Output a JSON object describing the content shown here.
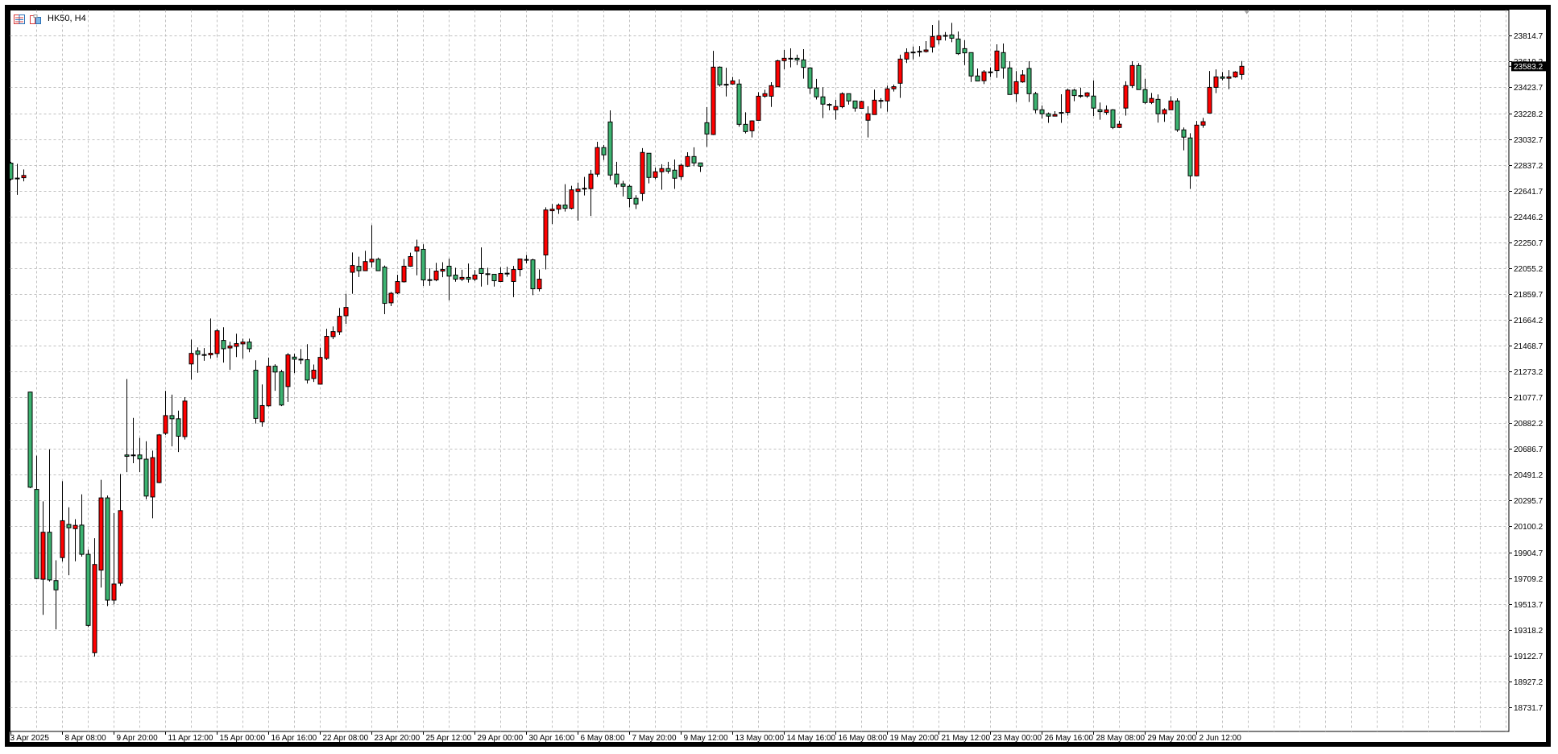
{
  "header": {
    "title": "HK50, H4",
    "icons": [
      "chart-list-icon",
      "one-click-trading-icon"
    ]
  },
  "colors": {
    "bull": "#ff0000",
    "bear": "#3cb371",
    "wick": "#000000",
    "grid": "#c0c0c0",
    "price_label_bg": "#000000",
    "price_label_fg": "#ffffff"
  },
  "current_price": "23583.2",
  "chart_data": {
    "type": "candlestick",
    "symbol": "HK50",
    "timeframe": "H4",
    "title": "HK50, H4",
    "xlabel": "",
    "ylabel": "",
    "ylim": [
      18548,
      24009
    ],
    "grid": true,
    "y_ticks": [
      "23814.7",
      "23619.2",
      "23423.7",
      "23228.2",
      "23032.7",
      "22837.2",
      "22641.7",
      "22446.2",
      "22250.7",
      "22055.2",
      "21859.7",
      "21664.2",
      "21468.7",
      "21273.2",
      "21077.7",
      "20882.2",
      "20686.7",
      "20491.2",
      "20295.7",
      "20100.2",
      "19904.7",
      "19709.2",
      "19513.7",
      "19318.2",
      "19122.7",
      "18927.2",
      "18731.7"
    ],
    "x_labels": [
      "3 Apr 2025",
      "8 Apr 08:00",
      "9 Apr 20:00",
      "11 Apr 12:00",
      "15 Apr 00:00",
      "16 Apr 16:00",
      "22 Apr 08:00",
      "23 Apr 20:00",
      "25 Apr 12:00",
      "29 Apr 00:00",
      "30 Apr 16:00",
      "6 May 08:00",
      "7 May 20:00",
      "9 May 12:00",
      "13 May 00:00",
      "14 May 16:00",
      "16 May 08:00",
      "19 May 20:00",
      "21 May 12:00",
      "23 May 00:00",
      "26 May 16:00",
      "28 May 08:00",
      "29 May 20:00",
      "2 Jun 12:00"
    ],
    "x_label_every_bars": 8,
    "ohlc_fields": [
      "open",
      "high",
      "low",
      "close"
    ],
    "ohlc": [
      [
        22850,
        22860,
        22720,
        22730
      ],
      [
        22737,
        22845,
        22610,
        22737
      ],
      [
        22740,
        22802,
        22712,
        22757
      ],
      [
        21117,
        21120,
        20390,
        20397
      ],
      [
        20380,
        20636,
        19700,
        19705
      ],
      [
        19700,
        20290,
        19431,
        20056
      ],
      [
        20056,
        20683,
        19683,
        19695
      ],
      [
        19690,
        19844,
        19321,
        19620
      ],
      [
        19864,
        20442,
        19834,
        20143
      ],
      [
        20115,
        20245,
        19730,
        20090
      ],
      [
        20083,
        20155,
        19836,
        20108
      ],
      [
        20110,
        20343,
        19871,
        19889
      ],
      [
        19889,
        19924,
        19338,
        19351
      ],
      [
        19144,
        20011,
        19114,
        19812
      ],
      [
        19769,
        20453,
        19637,
        20316
      ],
      [
        20316,
        20334,
        19497,
        19542
      ],
      [
        19542,
        20201,
        19510,
        19664
      ],
      [
        19670,
        20497,
        19650,
        20220
      ],
      [
        20641,
        21216,
        20511,
        20631
      ],
      [
        20641,
        20922,
        20579,
        20641
      ],
      [
        20641,
        20770,
        20511,
        20611
      ],
      [
        20609,
        20745,
        20305,
        20330
      ],
      [
        20323,
        20674,
        20162,
        20621
      ],
      [
        20432,
        20800,
        20427,
        20793
      ],
      [
        20805,
        21126,
        20793,
        20939
      ],
      [
        20939,
        21098,
        20706,
        20915
      ],
      [
        20915,
        20977,
        20663,
        20783
      ],
      [
        20780,
        21079,
        20758,
        21049
      ],
      [
        21330,
        21515,
        21211,
        21410
      ],
      [
        21428,
        21455,
        21263,
        21403
      ],
      [
        21401,
        21450,
        21354,
        21401
      ],
      [
        21399,
        21674,
        21370,
        21411
      ],
      [
        21409,
        21596,
        21378,
        21581
      ],
      [
        21508,
        21608,
        21340,
        21445
      ],
      [
        21451,
        21498,
        21285,
        21466
      ],
      [
        21463,
        21559,
        21382,
        21484
      ],
      [
        21482,
        21522,
        21370,
        21496
      ],
      [
        21496,
        21522,
        21419,
        21445
      ],
      [
        21283,
        21358,
        20879,
        20918
      ],
      [
        20891,
        21175,
        20855,
        21015
      ],
      [
        21013,
        21378,
        21007,
        21313
      ],
      [
        21313,
        21328,
        21127,
        21269
      ],
      [
        21271,
        21285,
        21011,
        21019
      ],
      [
        21159,
        21413,
        21043,
        21399
      ],
      [
        21382,
        21407,
        21261,
        21366
      ],
      [
        21366,
        21443,
        21328,
        21366
      ],
      [
        21362,
        21480,
        21182,
        21208
      ],
      [
        21220,
        21326,
        21194,
        21283
      ],
      [
        21177,
        21453,
        21173,
        21380
      ],
      [
        21372,
        21596,
        21360,
        21539
      ],
      [
        21537,
        21614,
        21518,
        21575
      ],
      [
        21573,
        21754,
        21549,
        21691
      ],
      [
        21695,
        21862,
        21634,
        21758
      ],
      [
        22024,
        22174,
        21862,
        22075
      ],
      [
        22069,
        22142,
        21988,
        22036
      ],
      [
        22036,
        22186,
        22036,
        22105
      ],
      [
        22103,
        22381,
        22061,
        22123
      ],
      [
        22123,
        22135,
        22036,
        22036
      ],
      [
        22063,
        22075,
        21707,
        21789
      ],
      [
        21793,
        21875,
        21768,
        21865
      ],
      [
        21867,
        22005,
        21859,
        21954
      ],
      [
        21952,
        22125,
        21946,
        22070
      ],
      [
        22070,
        22173,
        22066,
        22143
      ],
      [
        22184,
        22271,
        22001,
        22216
      ],
      [
        22198,
        22236,
        21920,
        21966
      ],
      [
        21968,
        22054,
        21922,
        21968
      ],
      [
        21966,
        22096,
        21956,
        22033
      ],
      [
        22033,
        22100,
        21987,
        22045
      ],
      [
        22070,
        22127,
        21812,
        21995
      ],
      [
        22003,
        22058,
        21952,
        21972
      ],
      [
        21972,
        22043,
        21958,
        21985
      ],
      [
        21985,
        22090,
        21946,
        21972
      ],
      [
        21972,
        22041,
        21958,
        22003
      ],
      [
        22052,
        22212,
        21916,
        22015
      ],
      [
        22013,
        22058,
        21928,
        22013
      ],
      [
        22009,
        22009,
        21916,
        21960
      ],
      [
        21954,
        22062,
        21954,
        22015
      ],
      [
        22017,
        22066,
        21990,
        22017
      ],
      [
        21954,
        22072,
        21836,
        22045
      ],
      [
        22045,
        22125,
        21993,
        22125
      ],
      [
        22121,
        22155,
        22092,
        22121
      ],
      [
        22118,
        22127,
        21851,
        21899
      ],
      [
        21899,
        22045,
        21879,
        21972
      ],
      [
        22155,
        22516,
        22045,
        22496
      ],
      [
        22490,
        22541,
        22389,
        22502
      ],
      [
        22502,
        22545,
        22466,
        22533
      ],
      [
        22533,
        22691,
        22484,
        22508
      ],
      [
        22508,
        22679,
        22500,
        22648
      ],
      [
        22636,
        22703,
        22415,
        22654
      ],
      [
        22660,
        22746,
        22606,
        22660
      ],
      [
        22657,
        22799,
        22450,
        22767
      ],
      [
        22767,
        23012,
        22746,
        22968
      ],
      [
        22968,
        22988,
        22874,
        22913
      ],
      [
        23162,
        23250,
        22722,
        22760
      ],
      [
        22767,
        22860,
        22667,
        22693
      ],
      [
        22693,
        22716,
        22598,
        22675
      ],
      [
        22675,
        22687,
        22515,
        22582
      ],
      [
        22584,
        22608,
        22503,
        22541
      ],
      [
        22620,
        22964,
        22564,
        22931
      ],
      [
        22925,
        22925,
        22697,
        22742
      ],
      [
        22742,
        22817,
        22728,
        22785
      ],
      [
        22785,
        22842,
        22649,
        22809
      ],
      [
        22809,
        22860,
        22771,
        22789
      ],
      [
        22797,
        22878,
        22655,
        22736
      ],
      [
        22748,
        22848,
        22724,
        22834
      ],
      [
        22827,
        22933,
        22821,
        22900
      ],
      [
        22900,
        22970,
        22827,
        22852
      ],
      [
        22852,
        22852,
        22783,
        22827
      ],
      [
        23156,
        23274,
        22974,
        23071
      ],
      [
        23067,
        23700,
        23063,
        23577
      ],
      [
        23577,
        23583,
        23430,
        23443
      ],
      [
        23447,
        23572,
        23355,
        23447
      ],
      [
        23449,
        23503,
        23443,
        23473
      ],
      [
        23449,
        23485,
        23126,
        23144
      ],
      [
        23144,
        23235,
        23075,
        23089
      ],
      [
        23095,
        23174,
        23045,
        23170
      ],
      [
        23174,
        23388,
        23174,
        23357
      ],
      [
        23357,
        23406,
        23345,
        23376
      ],
      [
        23357,
        23463,
        23276,
        23437
      ],
      [
        23428,
        23633,
        23428,
        23625
      ],
      [
        23626,
        23707,
        23561,
        23644
      ],
      [
        23644,
        23719,
        23575,
        23644
      ],
      [
        23644,
        23671,
        23593,
        23632
      ],
      [
        23632,
        23713,
        23490,
        23575
      ],
      [
        23571,
        23577,
        23374,
        23419
      ],
      [
        23419,
        23488,
        23332,
        23352
      ],
      [
        23352,
        23425,
        23191,
        23297
      ],
      [
        23295,
        23303,
        23250,
        23295
      ],
      [
        23254,
        23330,
        23179,
        23279
      ],
      [
        23277,
        23386,
        23266,
        23376
      ],
      [
        23376,
        23376,
        23293,
        23321
      ],
      [
        23321,
        23321,
        23240,
        23267
      ],
      [
        23265,
        23323,
        23265,
        23317
      ],
      [
        23175,
        23281,
        23045,
        23224
      ],
      [
        23218,
        23407,
        23218,
        23327
      ],
      [
        23325,
        23342,
        23265,
        23325
      ],
      [
        23321,
        23437,
        23240,
        23413
      ],
      [
        23413,
        23445,
        23392,
        23429
      ],
      [
        23455,
        23671,
        23344,
        23638
      ],
      [
        23638,
        23719,
        23608,
        23687
      ],
      [
        23691,
        23733,
        23636,
        23691
      ],
      [
        23697,
        23737,
        23656,
        23697
      ],
      [
        23695,
        23774,
        23687,
        23707
      ],
      [
        23729,
        23896,
        23687,
        23809
      ],
      [
        23784,
        23930,
        23748,
        23815
      ],
      [
        23817,
        23843,
        23778,
        23817
      ],
      [
        23821,
        23912,
        23766,
        23796
      ],
      [
        23790,
        23847,
        23669,
        23679
      ],
      [
        23717,
        23780,
        23593,
        23685
      ],
      [
        23687,
        23687,
        23465,
        23510
      ],
      [
        23510,
        23567,
        23472,
        23472
      ],
      [
        23474,
        23555,
        23449,
        23541
      ],
      [
        23541,
        23575,
        23502,
        23541
      ],
      [
        23551,
        23750,
        23496,
        23699
      ],
      [
        23687,
        23756,
        23490,
        23571
      ],
      [
        23571,
        23622,
        23370,
        23370
      ],
      [
        23376,
        23547,
        23313,
        23467
      ],
      [
        23465,
        23555,
        23459,
        23518
      ],
      [
        23567,
        23622,
        23313,
        23376
      ],
      [
        23376,
        23390,
        23228,
        23254
      ],
      [
        23254,
        23287,
        23187,
        23224
      ],
      [
        23224,
        23234,
        23155,
        23206
      ],
      [
        23206,
        23244,
        23206,
        23218
      ],
      [
        23234,
        23372,
        23155,
        23234
      ],
      [
        23234,
        23413,
        23210,
        23403
      ],
      [
        23403,
        23413,
        23319,
        23362
      ],
      [
        23362,
        23421,
        23344,
        23362
      ],
      [
        23358,
        23388,
        23344,
        23382
      ],
      [
        23358,
        23476,
        23206,
        23267
      ],
      [
        23254,
        23309,
        23179,
        23240
      ],
      [
        23234,
        23287,
        23216,
        23254
      ],
      [
        23254,
        23260,
        23108,
        23120
      ],
      [
        23120,
        23171,
        23116,
        23145
      ],
      [
        23267,
        23470,
        23210,
        23437
      ],
      [
        23437,
        23622,
        23419,
        23589
      ],
      [
        23589,
        23608,
        23407,
        23407
      ],
      [
        23407,
        23488,
        23297,
        23309
      ],
      [
        23309,
        23382,
        23297,
        23340
      ],
      [
        23333,
        23370,
        23157,
        23224
      ],
      [
        23224,
        23266,
        23163,
        23254
      ],
      [
        23254,
        23357,
        23254,
        23321
      ],
      [
        23321,
        23341,
        23087,
        23102
      ],
      [
        23102,
        23120,
        22947,
        23047
      ],
      [
        23041,
        23077,
        22655,
        22754
      ],
      [
        22754,
        23170,
        22754,
        23138
      ],
      [
        23138,
        23193,
        23118,
        23164
      ],
      [
        23229,
        23548,
        23229,
        23424
      ],
      [
        23424,
        23560,
        23380,
        23503
      ],
      [
        23503,
        23540,
        23477,
        23493
      ],
      [
        23493,
        23554,
        23410,
        23503
      ],
      [
        23503,
        23546,
        23497,
        23540
      ],
      [
        23522,
        23623,
        23483,
        23583.2
      ]
    ]
  }
}
